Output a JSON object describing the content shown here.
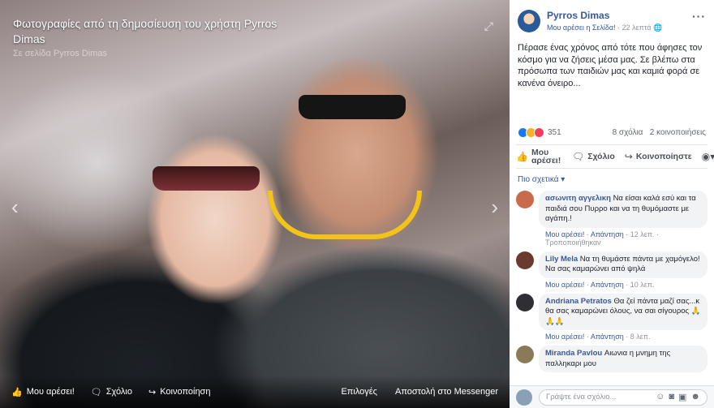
{
  "photo": {
    "title": "Φωτογραφίες από τη δημοσίευση του χρήστη Pyrros Dimas",
    "subtitle": "Σε σελίδα Pyrros Dimas",
    "bottom_bar": {
      "like": "Μου αρέσει!",
      "comment": "Σχόλιο",
      "share": "Κοινοποίηση",
      "options": "Επιλογές",
      "send_messenger": "Αποστολή στο Messenger"
    }
  },
  "post": {
    "author": "Pyrros Dimas",
    "page_like": "Μου αρέσει η Σελίδα!",
    "time": "22 λεπτά",
    "text": "Πέρασε ένας χρόνος από τότε που άφησες τον κόσμο για να ζήσεις μέσα μας. Σε βλέπω στα πρόσωπα των παιδιών μας και καμιά φορά σε κανένα όνειρο...",
    "reactions_count": "351",
    "comments_count": "8 σχόλια",
    "shares_count": "2 κοινοποιήσεις",
    "actions": {
      "like": "Μου αρέσει!",
      "comment": "Σχόλιο",
      "share": "Κοινοποίηστε"
    },
    "sort_label": "Πιο σχετικά ▾"
  },
  "comments": [
    {
      "name": "ασωνιτη αγγελικη",
      "text": "Να είσαι καλά εσύ και τα παιδιά σου Πυρρο και να τη θυμόμαστε με αγάπη.!",
      "like": "Μου αρέσει!",
      "reply": "Απάντηση",
      "time": "12 λεπ.",
      "extra": "Τροποποιήθηκαν",
      "color": "#c96a4a"
    },
    {
      "name": "Lily Mela",
      "text": "Να τη θυμάστε πάντα με χαμόγελο! Να σας καμαρώνει από ψηλά",
      "like": "Μου αρέσει!",
      "reply": "Απάντηση",
      "time": "10 λεπ.",
      "extra": "",
      "color": "#6a3a2e"
    },
    {
      "name": "Andriana Petratos",
      "text": "Θα ζεί πάντα μαζί σας...κ θα σας καμαρώνει όλους, να σαι σίγουρος 🙏🙏🙏",
      "like": "Μου αρέσει!",
      "reply": "Απάντηση",
      "time": "8 λεπ.",
      "extra": "",
      "color": "#2e2e34"
    },
    {
      "name": "Miranda Pavlou",
      "text": "Αιωνια η μνημη της παλληκαρι μου",
      "like": "",
      "reply": "",
      "time": "",
      "extra": "",
      "color": "#8a7a5a"
    }
  ],
  "composer": {
    "placeholder": "Γράψτε ένα σχόλιο..."
  }
}
